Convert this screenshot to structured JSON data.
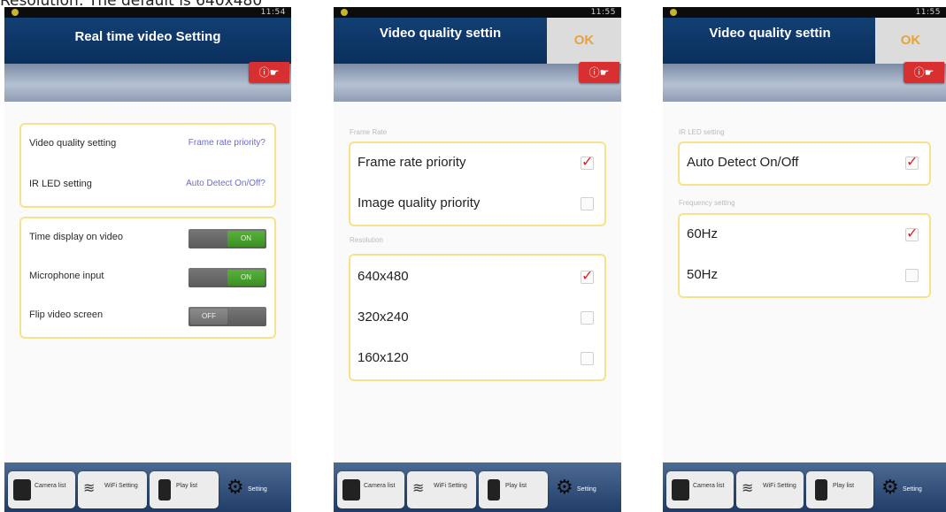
{
  "caption": "Resolution: The default is 640x480",
  "status_time_1": "11:54",
  "status_time_2": "11:55",
  "status_time_3": "11:55",
  "colors": {
    "title_bar": "#0b2f5d",
    "accent_check": "#dd2222",
    "group_border": "#f4e28c",
    "toggle_on": "#4aa030",
    "ok_text": "#e8a23c"
  },
  "screen1": {
    "title": "Real time video Setting",
    "rows": [
      {
        "label": "Video quality setting",
        "value": "Frame rate priority?"
      },
      {
        "label": "IR LED setting",
        "value": "Auto Detect On/Off?"
      }
    ],
    "toggles": [
      {
        "label": "Time display on video",
        "state": "ON"
      },
      {
        "label": "Microphone input",
        "state": "ON"
      },
      {
        "label": "Flip video screen",
        "state": "OFF"
      }
    ]
  },
  "screen2": {
    "title": "Video quality settin",
    "ok": "OK",
    "section_frame_rate": "Frame Rate",
    "frame_options": [
      {
        "label": "Frame rate priority",
        "checked": true
      },
      {
        "label": "Image quality priority",
        "checked": false
      }
    ],
    "section_resolution": "Resolution",
    "resolution_options": [
      {
        "label": "640x480",
        "checked": true
      },
      {
        "label": "320x240",
        "checked": false
      },
      {
        "label": "160x120",
        "checked": false
      }
    ]
  },
  "screen3": {
    "title": "Video quality settin",
    "ok": "OK",
    "section_ir": "IR LED setting",
    "ir_options": [
      {
        "label": "Auto Detect On/Off",
        "checked": true
      }
    ],
    "section_frequency": "Frequency setting",
    "freq_options": [
      {
        "label": "60Hz",
        "checked": true
      },
      {
        "label": "50Hz",
        "checked": false
      }
    ]
  },
  "tabs": [
    {
      "label": "Camera list",
      "icon": "camera-icon"
    },
    {
      "label": "WiFi Setting",
      "icon": "wifi-icon"
    },
    {
      "label": "Play list",
      "icon": "play-list-icon"
    },
    {
      "label": "Setting",
      "icon": "gear-icon"
    }
  ]
}
